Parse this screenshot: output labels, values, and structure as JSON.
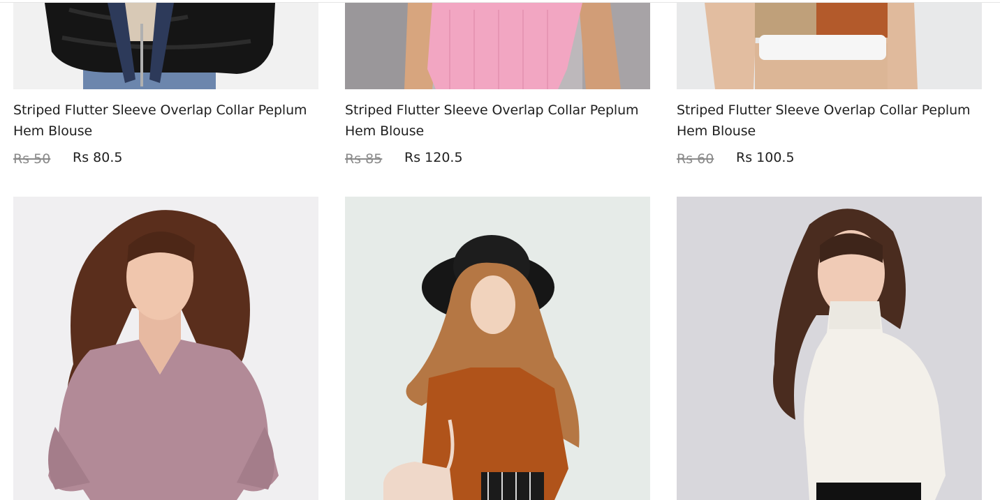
{
  "products_row1": [
    {
      "name": "Striped Flutter Sleeve Overlap Collar Peplum Hem Blouse",
      "old_price": "Rs 50",
      "new_price": "Rs 80.5",
      "image": "black-fur-jacket-photo"
    },
    {
      "name": "Striped Flutter Sleeve Overlap Collar Peplum Hem Blouse",
      "old_price": "Rs 85",
      "new_price": "Rs 120.5",
      "image": "pink-ribbed-top-photo"
    },
    {
      "name": "Striped Flutter Sleeve Overlap Collar Peplum Hem Blouse",
      "old_price": "Rs 60",
      "new_price": "Rs 100.5",
      "image": "color-block-crop-top-photo"
    }
  ],
  "products_row2": [
    {
      "image": "mauve-puff-sleeve-blouse-photo"
    },
    {
      "image": "hijab-black-hat-photo"
    },
    {
      "image": "white-turtleneck-photo"
    }
  ],
  "colors": {
    "old_price": "#8a8a8a",
    "text": "#202020"
  }
}
